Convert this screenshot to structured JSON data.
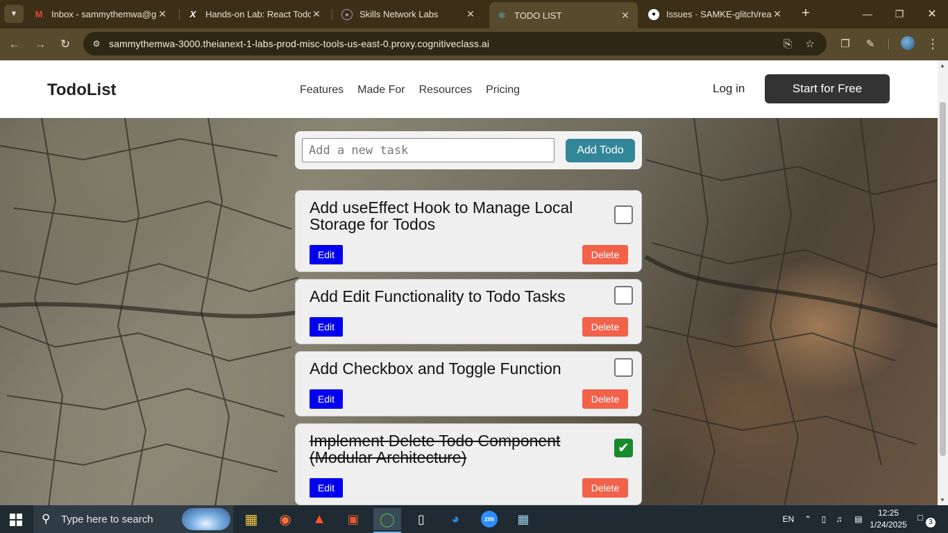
{
  "browser": {
    "tabs": [
      {
        "title": "Inbox - sammythemwa@gmail.com",
        "icon": "gmail-icon",
        "active": false
      },
      {
        "title": "Hands-on Lab: React Todo List",
        "icon": "x-icon",
        "active": false
      },
      {
        "title": "Skills Network Labs",
        "icon": "skills-network-icon",
        "active": false
      },
      {
        "title": "TODO LIST",
        "icon": "react-icon",
        "active": true
      },
      {
        "title": "Issues · SAMKE-glitch/react_todo",
        "icon": "github-icon",
        "active": false
      }
    ],
    "url": "sammythemwa-3000.theianext-1-labs-prod-misc-tools-us-east-0.proxy.cognitiveclass.ai"
  },
  "site": {
    "brand": "TodoList",
    "nav": [
      "Features",
      "Made For",
      "Resources",
      "Pricing"
    ],
    "login": "Log in",
    "cta": "Start for Free"
  },
  "add_form": {
    "placeholder": "Add a new task",
    "value": "",
    "button": "Add Todo"
  },
  "todos": [
    {
      "text": "Add useEffect Hook to Manage Local Storage for Todos",
      "completed": false,
      "edit_label": "Edit",
      "delete_label": "Delete"
    },
    {
      "text": "Add Edit Functionality to Todo Tasks",
      "completed": false,
      "edit_label": "Edit",
      "delete_label": "Delete"
    },
    {
      "text": "Add Checkbox and Toggle Function",
      "completed": false,
      "edit_label": "Edit",
      "delete_label": "Delete"
    },
    {
      "text": "Implement Delete Todo Component (Modular Architecture)",
      "completed": true,
      "edit_label": "Edit",
      "delete_label": "Delete"
    }
  ],
  "taskbar": {
    "search_placeholder": "Type here to search",
    "language": "EN",
    "time": "12:25",
    "date": "1/24/2025",
    "notification_count": "3"
  },
  "colors": {
    "add_button": "#338598",
    "edit_button": "#0000ee",
    "delete_button": "#f2614a",
    "checkbox_checked": "#1a8a2e",
    "cta_button": "#333333"
  }
}
